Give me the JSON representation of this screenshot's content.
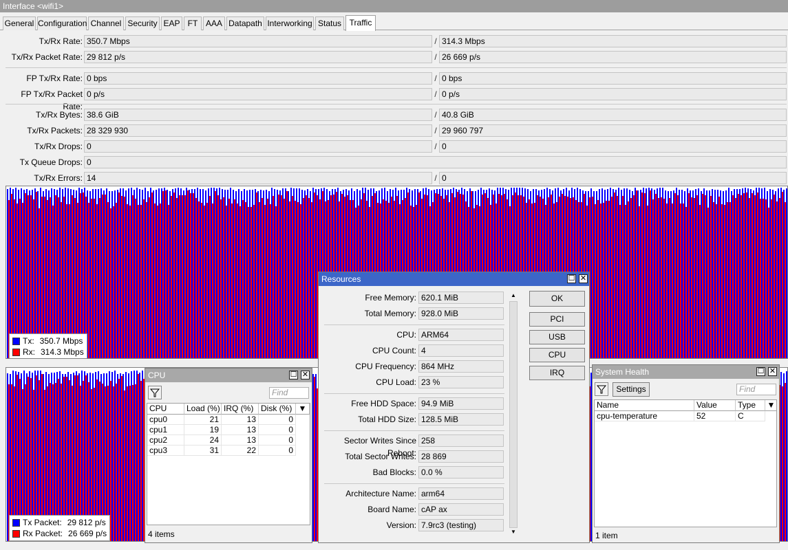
{
  "window": {
    "title": "Interface <wifi1>"
  },
  "tabs": [
    {
      "label": "General",
      "active": false
    },
    {
      "label": "Configuration",
      "active": false
    },
    {
      "label": "Channel",
      "active": false
    },
    {
      "label": "Security",
      "active": false
    },
    {
      "label": "EAP",
      "active": false
    },
    {
      "label": "FT",
      "active": false
    },
    {
      "label": "AAA",
      "active": false
    },
    {
      "label": "Datapath",
      "active": false
    },
    {
      "label": "Interworking",
      "active": false
    },
    {
      "label": "Status",
      "active": false
    },
    {
      "label": "Traffic",
      "active": true
    }
  ],
  "fields": [
    {
      "label": "Tx/Rx Rate:",
      "tx": "350.7 Mbps",
      "rx": "314.3 Mbps"
    },
    {
      "label": "Tx/Rx Packet Rate:",
      "tx": "29 812 p/s",
      "rx": "26 669 p/s"
    },
    {
      "label": "FP Tx/Rx Rate:",
      "tx": "0 bps",
      "rx": "0 bps"
    },
    {
      "label": "FP Tx/Rx Packet Rate:",
      "tx": "0 p/s",
      "rx": "0 p/s"
    },
    {
      "label": "Tx/Rx Bytes:",
      "tx": "38.6 GiB",
      "rx": "40.8 GiB"
    },
    {
      "label": "Tx/Rx Packets:",
      "tx": "28 329 930",
      "rx": "29 960 797"
    },
    {
      "label": "Tx/Rx Drops:",
      "tx": "0",
      "rx": "0"
    },
    {
      "label": "Tx Queue Drops:",
      "tx": "0"
    },
    {
      "label": "Tx/Rx Errors:",
      "tx": "14",
      "rx": "0"
    }
  ],
  "separator_text": "/",
  "colors": {
    "tx": "#0000ff",
    "rx": "#ff0000",
    "window_title_active": "#3c66c8",
    "window_title_inactive": "#a8a8a8"
  },
  "traffic_graph": {
    "legend": [
      {
        "label": "Tx:",
        "value": "350.7 Mbps",
        "color": "#0000ff"
      },
      {
        "label": "Rx:",
        "value": "314.3 Mbps",
        "color": "#ff0000"
      }
    ]
  },
  "packet_graph": {
    "legend": [
      {
        "label": "Tx Packet:",
        "value": "29 812 p/s",
        "color": "#0000ff"
      },
      {
        "label": "Rx Packet:",
        "value": "26 669 p/s",
        "color": "#ff0000"
      }
    ]
  },
  "resources": {
    "title": "Resources",
    "groups": [
      [
        {
          "label": "Free Memory:",
          "value": "620.1 MiB"
        },
        {
          "label": "Total Memory:",
          "value": "928.0 MiB"
        }
      ],
      [
        {
          "label": "CPU:",
          "value": "ARM64"
        },
        {
          "label": "CPU Count:",
          "value": "4"
        },
        {
          "label": "CPU Frequency:",
          "value": "864 MHz"
        },
        {
          "label": "CPU Load:",
          "value": "23 %"
        }
      ],
      [
        {
          "label": "Free HDD Space:",
          "value": "94.9 MiB"
        },
        {
          "label": "Total HDD Size:",
          "value": "128.5 MiB"
        }
      ],
      [
        {
          "label": "Sector Writes Since Reboot:",
          "value": "258"
        },
        {
          "label": "Total Sector Writes:",
          "value": "28 869"
        },
        {
          "label": "Bad Blocks:",
          "value": "0.0 %"
        }
      ],
      [
        {
          "label": "Architecture Name:",
          "value": "arm64"
        },
        {
          "label": "Board Name:",
          "value": "cAP ax"
        },
        {
          "label": "Version:",
          "value": "7.9rc3 (testing)"
        }
      ]
    ],
    "buttons": [
      "OK",
      "PCI",
      "USB",
      "CPU",
      "IRQ"
    ]
  },
  "cpu_window": {
    "title": "CPU",
    "find_placeholder": "Find",
    "columns": [
      "CPU",
      "Load (%)",
      "IRQ (%)",
      "Disk (%)"
    ],
    "rows": [
      [
        "cpu0",
        "21",
        "13",
        "0"
      ],
      [
        "cpu1",
        "19",
        "13",
        "0"
      ],
      [
        "cpu2",
        "24",
        "13",
        "0"
      ],
      [
        "cpu3",
        "31",
        "22",
        "0"
      ]
    ],
    "status": "4 items"
  },
  "health_window": {
    "title": "System Health",
    "settings_label": "Settings",
    "find_placeholder": "Find",
    "columns": [
      "Name",
      "Value",
      "Type"
    ],
    "rows": [
      [
        "cpu-temperature",
        "52",
        "C"
      ]
    ],
    "status": "1 item"
  }
}
